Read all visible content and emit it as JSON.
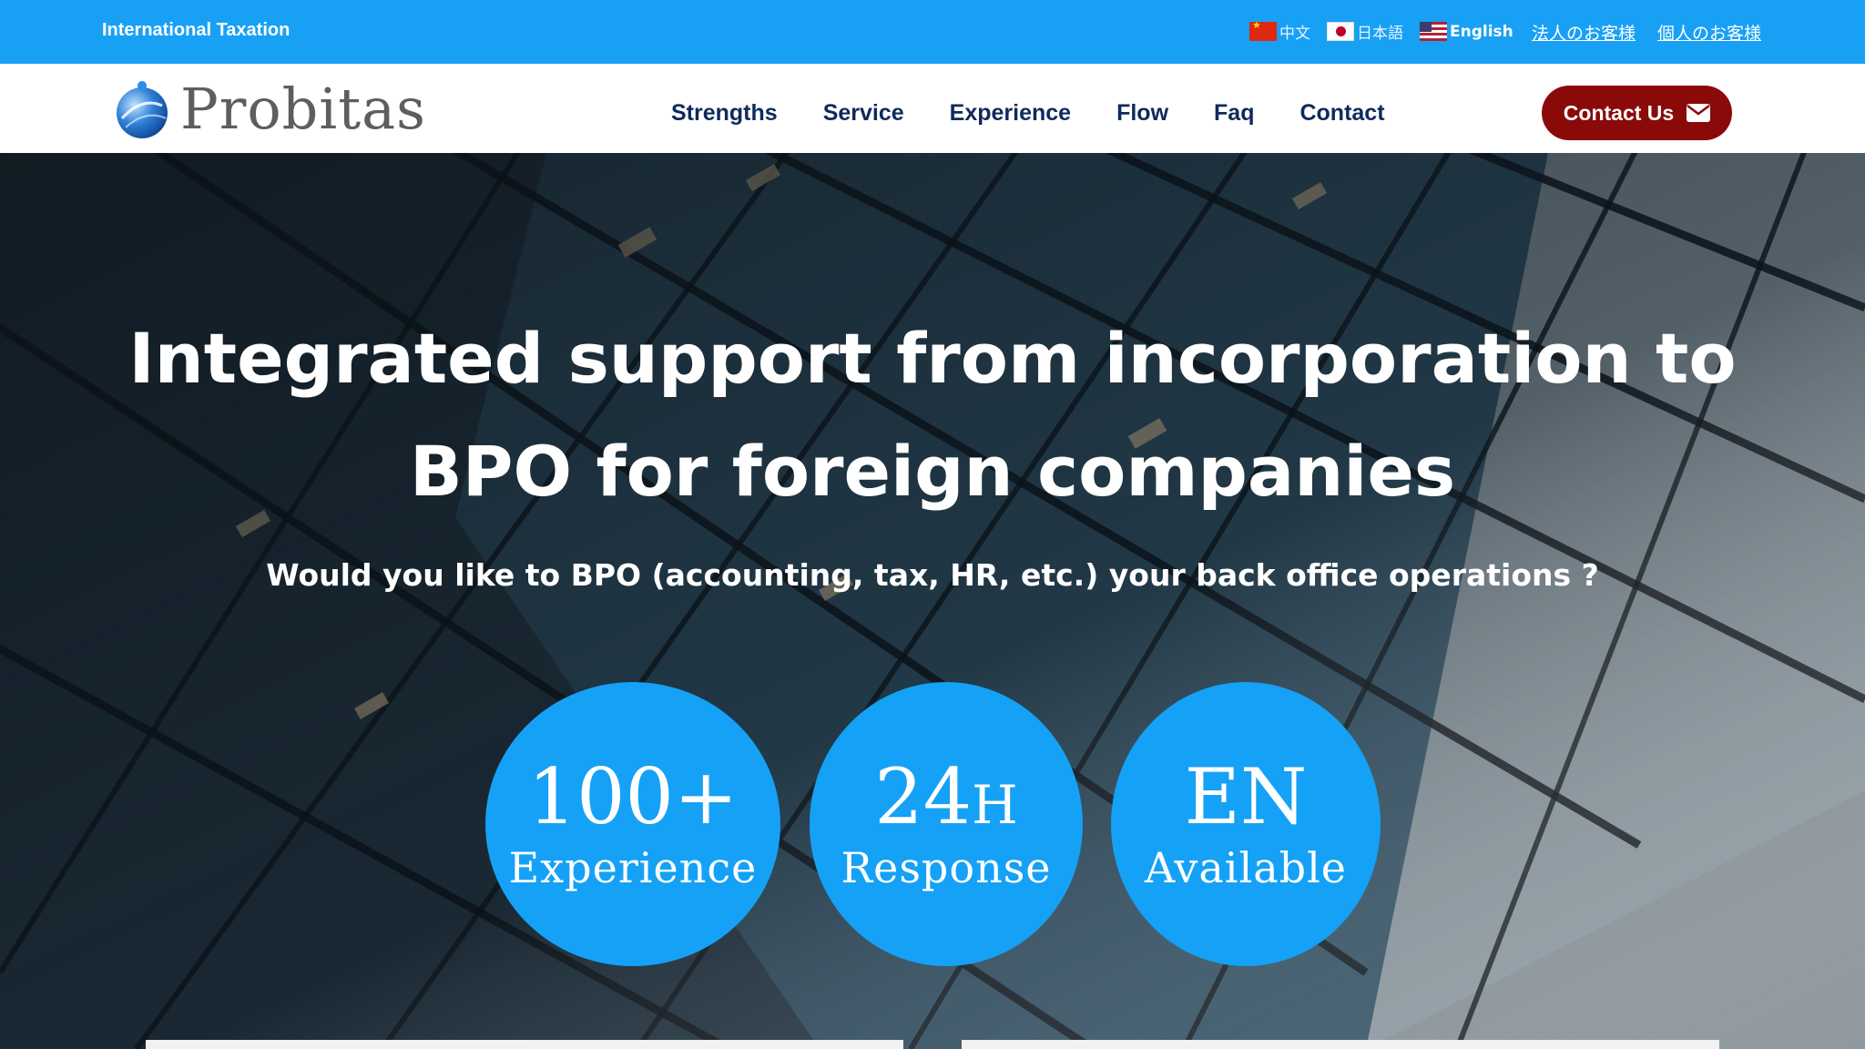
{
  "topbar": {
    "site_label": "International Taxation",
    "languages": [
      {
        "flag": "china-flag-icon",
        "label": "中文"
      },
      {
        "flag": "japan-flag-icon",
        "label": "日本語"
      },
      {
        "flag": "usa-flag-icon",
        "label": "English",
        "active": true
      }
    ],
    "links": [
      "法人のお客様",
      "個人のお客様"
    ],
    "background_color": "#18a0f5"
  },
  "nav": {
    "logo_text": "Probitas",
    "menu": [
      "Strengths",
      "Service",
      "Experience",
      "Flow",
      "Faq",
      "Contact"
    ],
    "contact_button": "Contact Us",
    "contact_button_icon": "envelope-icon",
    "menu_color": "#0f2a5c",
    "button_color": "#8a0a0a"
  },
  "hero": {
    "title_line1": "Integrated support from incorporation to",
    "title_line2": "BPO for foreign companies",
    "subtitle": "Would you like to BPO (accounting, tax, HR, etc.) your back office operations ?",
    "badges": [
      {
        "value": "100+",
        "unit": "",
        "label": "Experience"
      },
      {
        "value": "24",
        "unit": "H",
        "label": "Response"
      },
      {
        "value": "EN",
        "unit": "",
        "label": "Available"
      }
    ],
    "badge_color": "#15a1f6"
  }
}
